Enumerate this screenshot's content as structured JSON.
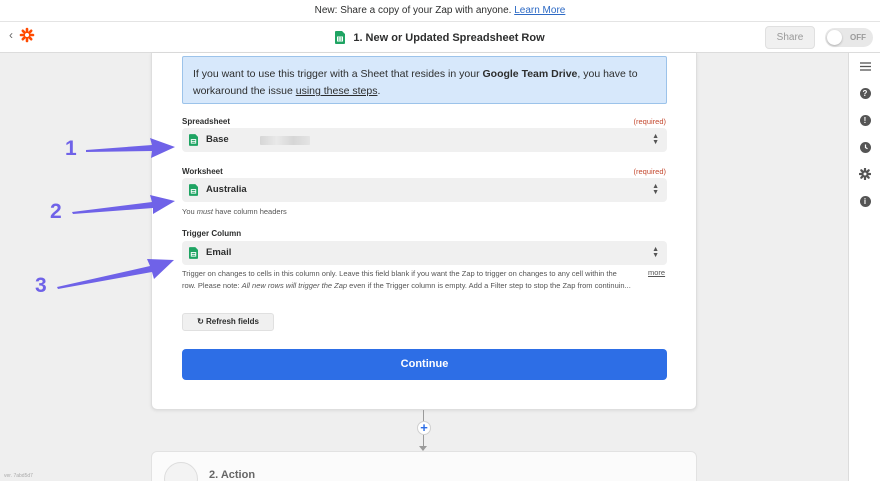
{
  "banner": {
    "text": "New: Share a copy of your Zap with anyone.",
    "link": "Learn More"
  },
  "topbar": {
    "step_title": "1. New or Updated Spreadsheet Row",
    "share_label": "Share",
    "toggle_label": "OFF"
  },
  "info": {
    "text_before": "If you want to use this trigger with a Sheet that resides in your ",
    "bold": "Google Team Drive",
    "text_after": ", you have to workaround the issue ",
    "link": "using these steps",
    "end": "."
  },
  "fields": {
    "spreadsheet": {
      "label": "Spreadsheet",
      "required": "(required)",
      "value": "Base"
    },
    "worksheet": {
      "label": "Worksheet",
      "required": "(required)",
      "value": "Australia",
      "help_before": "You ",
      "help_em": "must",
      "help_after": " have column headers"
    },
    "trigger_column": {
      "label": "Trigger Column",
      "value": "Email",
      "help_line1": "Trigger on changes to cells in this column only. Leave this field blank if you want the Zap to trigger on changes to any cell within the",
      "help_line2_before": "row. Please note: ",
      "help_line2_em": "All new rows will trigger the Zap",
      "help_line2_after": " even if the Trigger column is empty. Add a Filter step to stop the Zap from continuin...",
      "more": "more"
    }
  },
  "buttons": {
    "refresh": "Refresh fields",
    "continue": "Continue"
  },
  "next_step": {
    "title": "2. Action"
  },
  "version": "ver. 7abd5d7",
  "annotations": [
    "1",
    "2",
    "3"
  ],
  "colors": {
    "accent_blue": "#2d6ee6",
    "annotation_purple": "#6f62e8",
    "sheets_green": "#1fa463",
    "zapier_orange": "#ff4a00",
    "required_red": "#c4492f"
  },
  "icons": {
    "back": "chevron-left-icon",
    "logo": "zapier-logo-icon",
    "sheets": "google-sheets-icon",
    "sidebar": [
      "menu-icon",
      "help-icon",
      "alert-icon",
      "clock-icon",
      "gear-icon",
      "info-icon"
    ]
  }
}
